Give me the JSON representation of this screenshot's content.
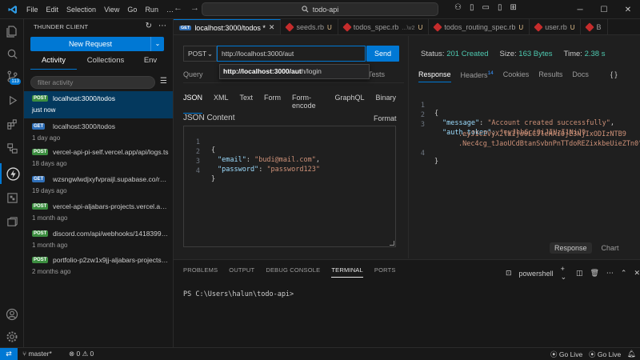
{
  "titlebar": {
    "menu": [
      "File",
      "Edit",
      "Selection",
      "View",
      "Go",
      "Run",
      "…"
    ],
    "search": "todo-api"
  },
  "activitybar": {
    "icons": [
      "explorer-icon",
      "search-icon",
      "source-control-icon",
      "run-debug-icon",
      "extensions-icon",
      "remote-explorer-icon",
      "thunder-client-icon",
      "database-icon",
      "docker-icon",
      "account-icon",
      "settings-icon"
    ],
    "source_control_badge": "113"
  },
  "sidebar": {
    "title": "THUNDER CLIENT",
    "new_request": "New Request",
    "tabs": [
      "Activity",
      "Collections",
      "Env"
    ],
    "filter_placeholder": "filter activity",
    "items": [
      {
        "method": "POST",
        "url": "localhost:3000/todos",
        "time": "just now"
      },
      {
        "method": "GET",
        "url": "localhost:3000/todos",
        "time": "1 day ago"
      },
      {
        "method": "POST",
        "url": "vercel-api-pi-self.vercel.app/api/logs.ts",
        "time": "18 days ago"
      },
      {
        "method": "GET",
        "url": "wzsngwlwdjxyfvpraijl.supabase.co/rest/v...",
        "time": "19 days ago"
      },
      {
        "method": "POST",
        "url": "vercel-api-aljabars-projects.vercel.app/...",
        "time": "1 month ago"
      },
      {
        "method": "POST",
        "url": "discord.com/api/webhooks/14183999...",
        "time": "1 month ago"
      },
      {
        "method": "POST",
        "url": "portfolio-p2zw1x9jj-aljabars-projects.v...",
        "time": "2 months ago"
      }
    ]
  },
  "tabs": [
    {
      "label": "localhost:3000/todos *",
      "badge": "GET"
    },
    {
      "label": "seeds.rb",
      "status": "U"
    },
    {
      "label": "todos_spec.rb",
      "path": "...\\v2",
      "status": "U"
    },
    {
      "label": "todos_routing_spec.rb",
      "status": "U"
    },
    {
      "label": "user.rb",
      "status": "U"
    },
    {
      "label": "B",
      "status": ""
    }
  ],
  "request": {
    "method": "POST",
    "url": "http://localhost:3000/aut",
    "send": "Send",
    "autocomplete_bold": "http://localhost:3000/aut",
    "autocomplete_rest": "h/login",
    "top_tab": "Query",
    "top_tab_right": "Tests",
    "body_tabs": [
      "JSON",
      "XML",
      "Text",
      "Form",
      "Form-encode",
      "GraphQL",
      "Binary"
    ],
    "content_label": "JSON Content",
    "format": "Format",
    "line_numbers": [
      "1",
      "2",
      "3",
      "4"
    ],
    "body_lines": [
      {
        "p1": "{"
      },
      {
        "k": "\"email\"",
        "p1": ": ",
        "s": "\"budi@mail.com\"",
        "p2": ","
      },
      {
        "k": "\"password\"",
        "p1": ": ",
        "s": "\"password123\"",
        "p2": ""
      },
      {
        "p1": "}"
      }
    ]
  },
  "response": {
    "status_label": "Status:",
    "status_value": "201 Created",
    "size_label": "Size:",
    "size_value": "163 Bytes",
    "time_label": "Time:",
    "time_value": "2.38 s",
    "tabs": [
      "Response",
      "Headers",
      "Cookies",
      "Results",
      "Docs"
    ],
    "headers_count": "14",
    "braces": "{ }",
    "line_numbers": [
      "1",
      "2",
      "3",
      "",
      "",
      "4"
    ],
    "lines": [
      {
        "p1": "{"
      },
      {
        "k": "\"message\"",
        "p1": ": ",
        "s": "\"Account created successfully\"",
        "p2": ","
      },
      {
        "k": "\"auth_token\"",
        "p1": ": ",
        "s": "\"eyJhbGciOiJIUzI1NiJ9",
        "p2": ""
      },
      {
        "s": ".eyJ1c2VyX2lkIjo0LCJleHAiOjE3NjIxODIzNTB9"
      },
      {
        "s": ".Nec4cg_tJaoUCdBtanSvbnPnTTdoREZixkbeUieZTn0\""
      },
      {
        "p1": "}"
      }
    ],
    "bottom_tabs": [
      "Response",
      "Chart"
    ]
  },
  "panel": {
    "tabs": [
      "PROBLEMS",
      "OUTPUT",
      "DEBUG CONSOLE",
      "TERMINAL",
      "PORTS"
    ],
    "shell": "powershell",
    "prompt": "PS C:\\Users\\halun\\todo-api>"
  },
  "statusbar": {
    "branch": "master*",
    "problems": "0 ⚠ 0",
    "golive1": "Go Live",
    "golive2": "Go Live"
  },
  "colors": {
    "accent": "#0078d4",
    "post": "#3c8e40",
    "get": "#2f6fb8",
    "status_ok": "#4ec9b0"
  }
}
